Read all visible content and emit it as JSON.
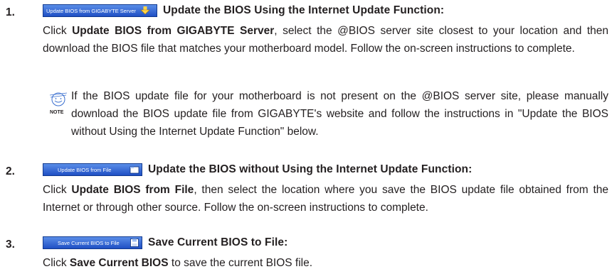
{
  "items": [
    {
      "number": "1.",
      "button_label": "Update BIOS from GIGABYTE Server",
      "button_icon": "download-arrow-icon",
      "heading": "Update the BIOS Using the Internet Update Function:",
      "para_lead": "Click ",
      "para_bold": "Update BIOS from GIGABYTE Server",
      "para_rest": ", select the @BIOS server site closest to your location and then download the BIOS file that matches your motherboard model. Follow the on-screen instructions to complete.",
      "note_label": "NOTE",
      "note_text": "If the BIOS update file for your motherboard is not present on the @BIOS server site, please manually download the BIOS update file from GIGABYTE's website and follow the instructions in \"Update the BIOS without Using the Internet Update Function\" below."
    },
    {
      "number": "2.",
      "button_label": "Update BIOS from File",
      "button_icon": "folder-icon",
      "heading": "Update the BIOS without Using the Internet Update Function:",
      "para_lead": "Click ",
      "para_bold": "Update BIOS from File",
      "para_rest": ", then select the location where you save the BIOS update file obtained from the Internet or through other source. Follow the on-screen instructions to complete."
    },
    {
      "number": "3.",
      "button_label": "Save Current BIOS to File",
      "button_icon": "floppy-disk-icon",
      "heading": "Save Current BIOS to File:",
      "para_lead": "Click ",
      "para_bold": "Save Current BIOS",
      "para_rest": " to save the current BIOS file."
    }
  ]
}
